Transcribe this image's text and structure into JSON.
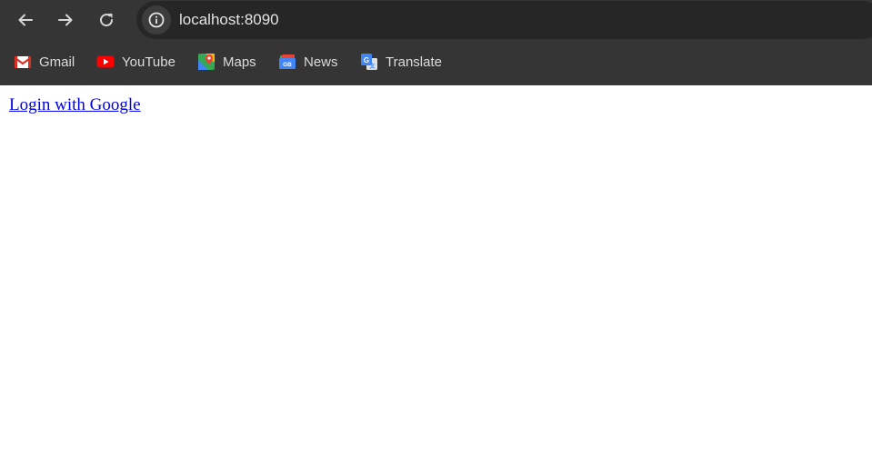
{
  "browser": {
    "url": "localhost:8090",
    "bookmarks": [
      {
        "label": "Gmail",
        "icon": "gmail-icon"
      },
      {
        "label": "YouTube",
        "icon": "youtube-icon"
      },
      {
        "label": "Maps",
        "icon": "maps-icon"
      },
      {
        "label": "News",
        "icon": "news-icon"
      },
      {
        "label": "Translate",
        "icon": "translate-icon"
      }
    ],
    "colors": {
      "toolbar": "#353535",
      "omnibox": "#262626",
      "text": "#e3e3e3"
    }
  },
  "page": {
    "login_link": "Login with Google",
    "link_color": "#0000ee"
  }
}
